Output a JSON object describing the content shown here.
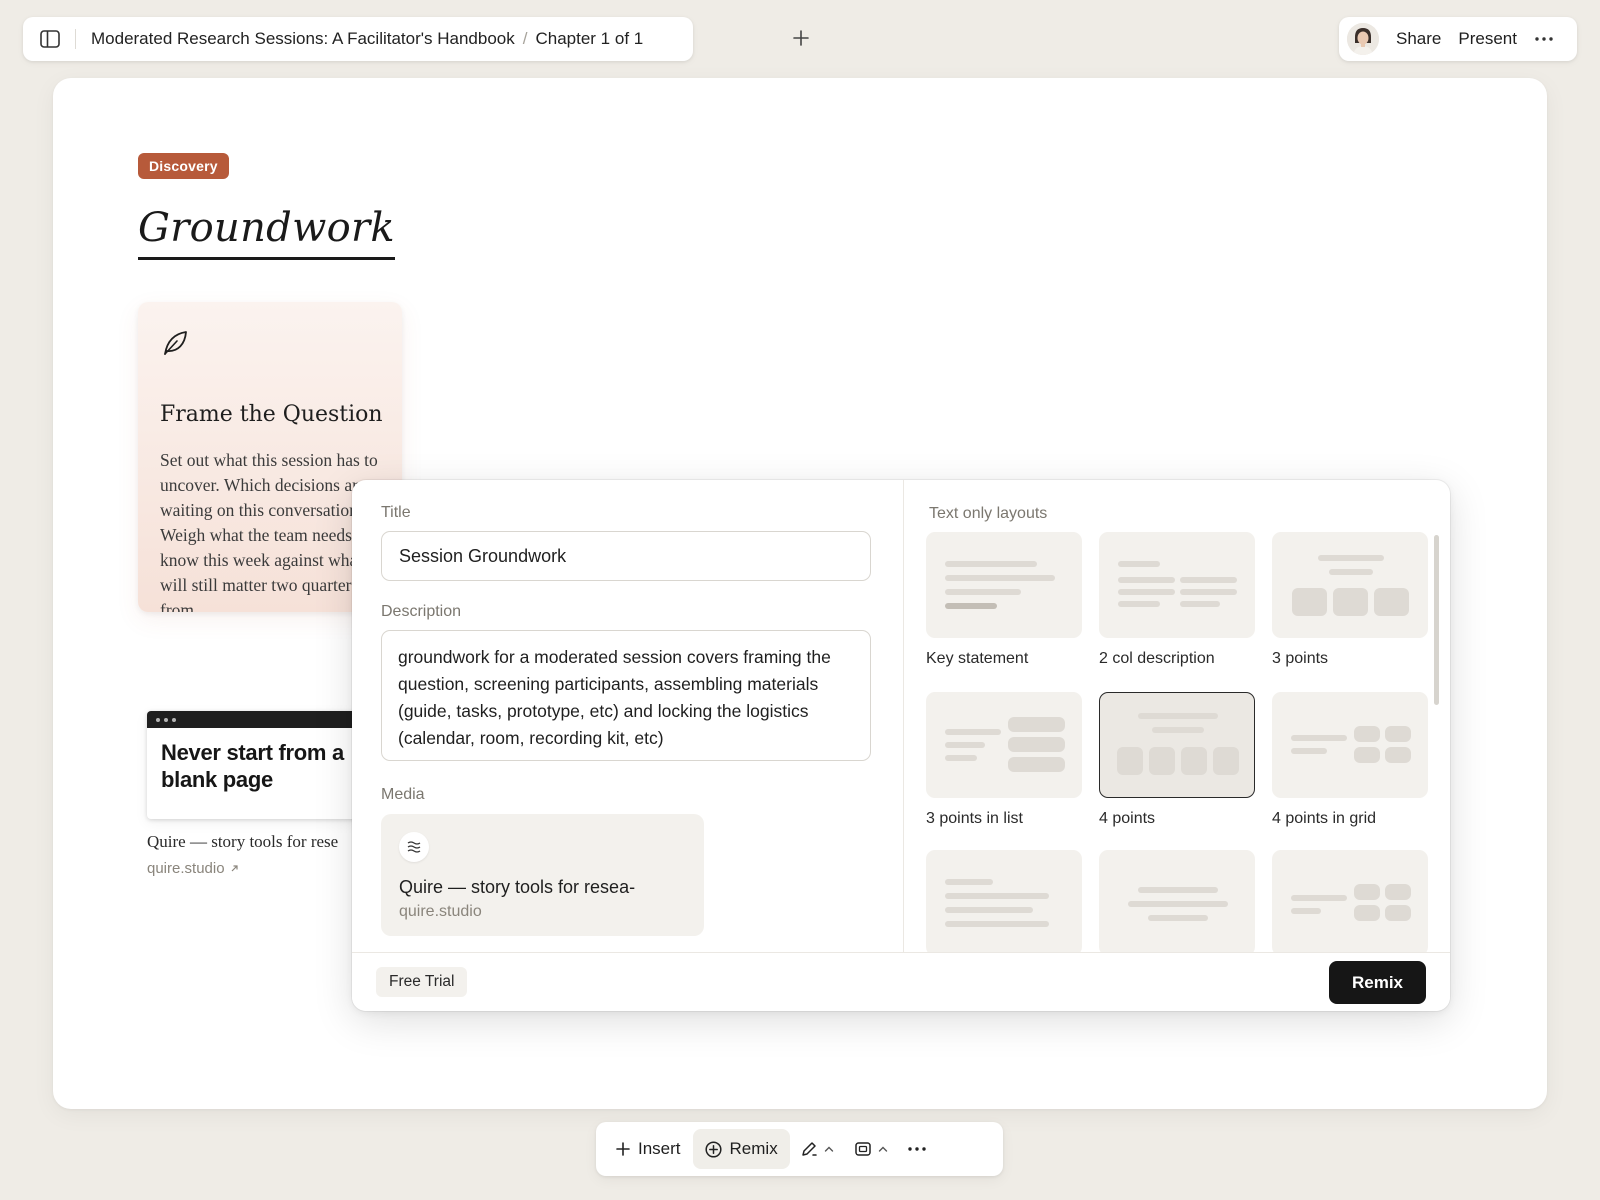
{
  "topbar": {
    "breadcrumb_doc": "Moderated Research Sessions: A Facilitator's Handbook",
    "breadcrumb_sep": "/",
    "breadcrumb_chapter": "Chapter 1 of 1",
    "share_label": "Share",
    "present_label": "Present"
  },
  "page": {
    "tag": "Discovery",
    "title": "Groundwork",
    "accent_color": "#b75a3a"
  },
  "card_frame": {
    "icon": "leaf-icon",
    "title": "Frame the Question",
    "body": "Set out what this session has to uncover. Which decisions are waiting on this conversation? Weigh what the team needs to know this week against what will still matter two quarters from"
  },
  "web_card": {
    "headline": "Never start from a blank page",
    "caption": "Quire — story tools for rese",
    "url": "quire.studio"
  },
  "remix_panel": {
    "title_label": "Title",
    "title_value": "Session Groundwork",
    "description_label": "Description",
    "description_value": "groundwork for a moderated session covers framing the question, screening participants, assembling materials (guide, tasks, prototype, etc) and locking the logistics (calendar, room, recording kit, etc)",
    "media_label": "Media",
    "media_title": "Quire — story tools for resea-",
    "media_url": "quire.studio",
    "layouts_label": "Text only layouts",
    "layouts": [
      {
        "name": "Key statement",
        "selected": false
      },
      {
        "name": "2 col description",
        "selected": false
      },
      {
        "name": "3 points",
        "selected": false
      },
      {
        "name": "3 points in list",
        "selected": false
      },
      {
        "name": "4 points",
        "selected": true
      },
      {
        "name": "4 points in grid",
        "selected": false
      }
    ],
    "free_trial_label": "Free Trial",
    "remix_button_label": "Remix"
  },
  "bottom_toolbar": {
    "insert_label": "Insert",
    "remix_label": "Remix"
  }
}
